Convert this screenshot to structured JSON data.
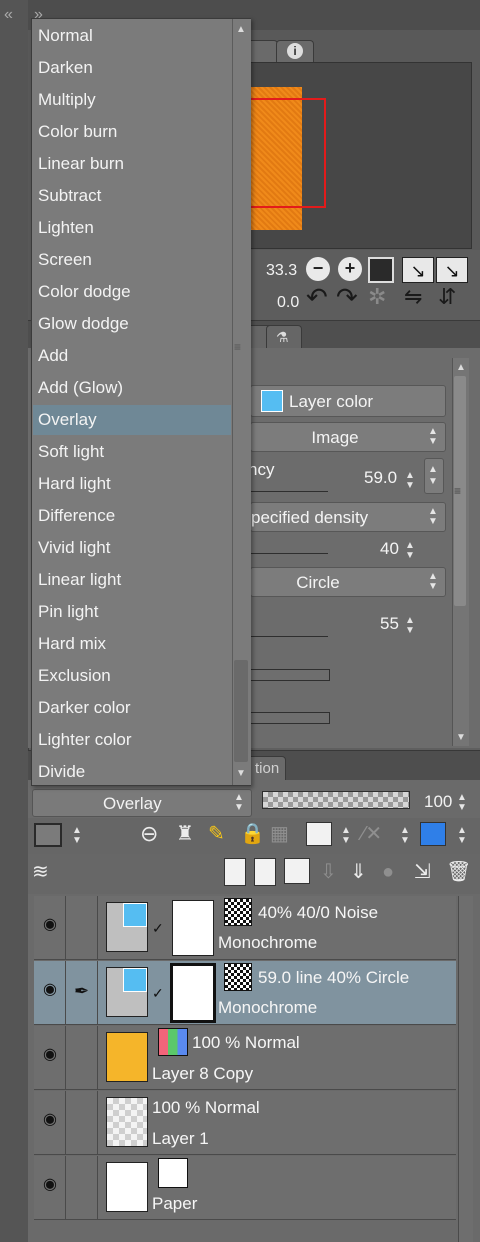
{
  "navigator": {
    "zoom": "33.3",
    "rotation": "0.0"
  },
  "properties": {
    "layer_color_label": "Layer color",
    "expression_value": "Image",
    "opacity_label": "ncy",
    "opacity_value": "59.0",
    "density_mode": "pecified density",
    "density_value": "40",
    "shape_value": "Circle",
    "angle_value": "55",
    "colors": {
      "layer_color_swatch": "#55bdf2"
    }
  },
  "layer_panel": {
    "tab_fragment": "tion",
    "blend_mode": "Overlay",
    "opacity": "100",
    "layers": [
      {
        "title": "40% 40/0 Noise",
        "subtitle": "Monochrome",
        "selected": false
      },
      {
        "title": "59.0 line 40% Circle",
        "subtitle": "Monochrome",
        "selected": true
      },
      {
        "title": "100 % Normal",
        "subtitle": "Layer 8 Copy",
        "selected": false
      },
      {
        "title": "100 % Normal",
        "subtitle": "Layer 1",
        "selected": false
      },
      {
        "title": "",
        "subtitle": "Paper",
        "selected": false
      }
    ],
    "colors": {
      "selected_row": "#80939f",
      "layer8_fill": "#f5b52a"
    }
  },
  "blend_dropdown": {
    "items": [
      "Normal",
      "Darken",
      "Multiply",
      "Color burn",
      "Linear burn",
      "Subtract",
      "Lighten",
      "Screen",
      "Color dodge",
      "Glow dodge",
      "Add",
      "Add (Glow)",
      "Overlay",
      "Soft light",
      "Hard light",
      "Difference",
      "Vivid light",
      "Linear light",
      "Pin light",
      "Hard mix",
      "Exclusion",
      "Darker color",
      "Lighter color",
      "Divide"
    ],
    "selected": "Overlay",
    "colors": {
      "highlight": "#6f8896"
    }
  }
}
